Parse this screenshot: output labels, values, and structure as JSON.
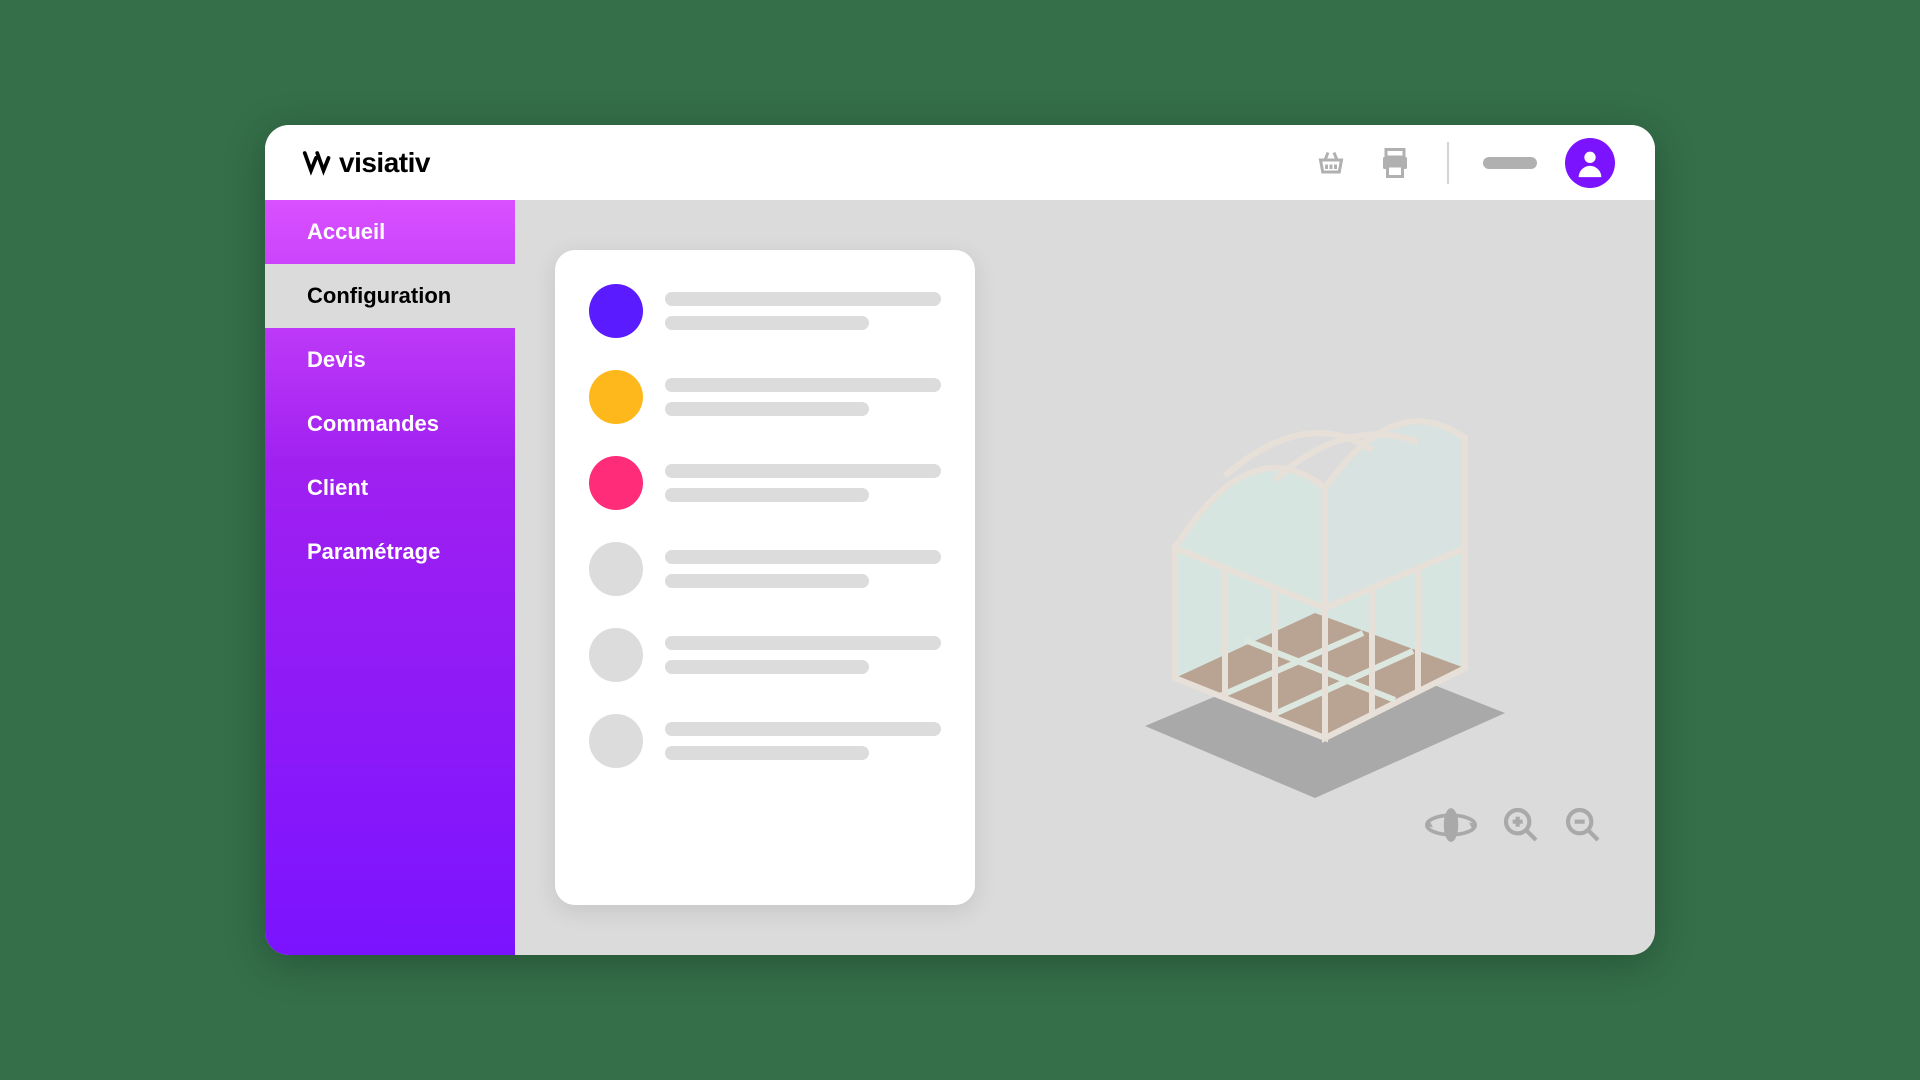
{
  "brand": {
    "name": "visiativ"
  },
  "header": {
    "icons": [
      "basket",
      "printer"
    ],
    "avatar": "user"
  },
  "sidebar": {
    "items": [
      {
        "label": "Accueil",
        "selected": false
      },
      {
        "label": "Configuration",
        "selected": true
      },
      {
        "label": "Devis",
        "selected": false
      },
      {
        "label": "Commandes",
        "selected": false
      },
      {
        "label": "Client",
        "selected": false
      },
      {
        "label": "Paramétrage",
        "selected": false
      }
    ]
  },
  "configurator": {
    "options": [
      {
        "color": "#5a1bff"
      },
      {
        "color": "#ffb81c"
      },
      {
        "color": "#ff2c7a"
      },
      {
        "color": "#dcdcdc"
      },
      {
        "color": "#dcdcdc"
      },
      {
        "color": "#dcdcdc"
      }
    ]
  },
  "viewer": {
    "model": "greenhouse-3d",
    "controls": [
      "rotate-3d",
      "zoom-in",
      "zoom-out"
    ]
  }
}
